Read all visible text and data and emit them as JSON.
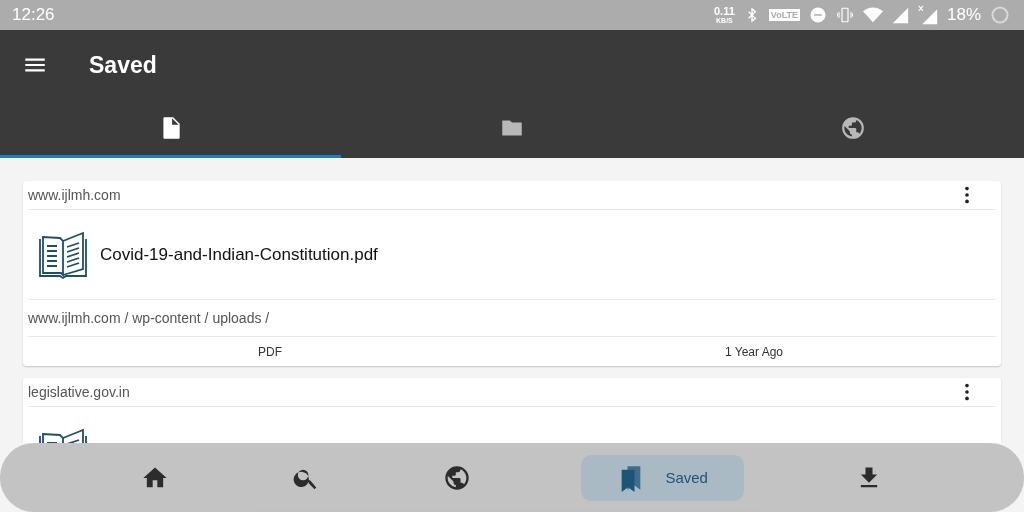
{
  "status_bar": {
    "time": "12:26",
    "speed": "0.11",
    "speed_unit": "KB/S",
    "volte": "VoLTE",
    "battery": "18%"
  },
  "app_bar": {
    "title": "Saved"
  },
  "tabs": [
    {
      "kind": "file",
      "selected": true
    },
    {
      "kind": "folder",
      "selected": false
    },
    {
      "kind": "globe",
      "selected": false
    }
  ],
  "cards": [
    {
      "site": "www.ijlmh.com",
      "title": "Covid-19-and-Indian-Constitution.pdf",
      "path": "www.ijlmh.com / wp-content / uploads /",
      "type": "PDF",
      "age": "1 Year Ago"
    },
    {
      "site": "legislative.gov.in"
    }
  ],
  "bottom_nav": [
    {
      "kind": "home",
      "selected": false
    },
    {
      "kind": "search",
      "selected": false
    },
    {
      "kind": "globe",
      "selected": false
    },
    {
      "kind": "saved",
      "label": "Saved",
      "selected": true
    },
    {
      "kind": "download",
      "selected": false
    }
  ]
}
